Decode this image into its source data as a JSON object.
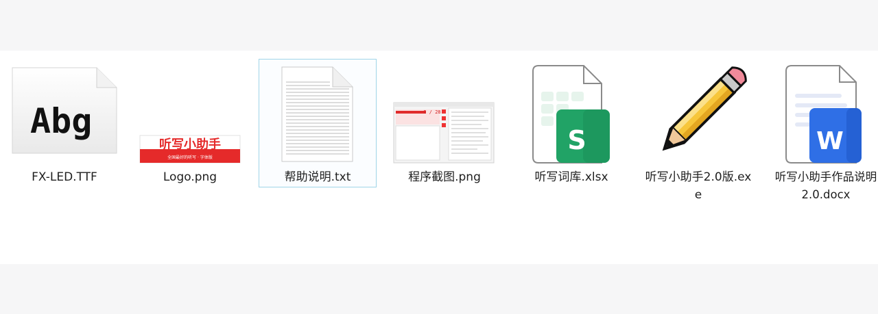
{
  "files": [
    {
      "name": "FX-LED.TTF",
      "icon": "font-file-icon",
      "preview": "Abg"
    },
    {
      "name": "Logo.png",
      "icon": "image-file-icon",
      "preview": {
        "title": "听写小助手",
        "subtitle": "全国最好的听写 · 字体版"
      }
    },
    {
      "name": "帮助说明.txt",
      "icon": "text-file-icon",
      "selected": true
    },
    {
      "name": "程序截图.png",
      "icon": "screenshot-thumbnail-icon",
      "preview": {
        "counter": "2 / 28"
      }
    },
    {
      "name": "听写词库.xlsx",
      "icon": "spreadsheet-file-icon",
      "badge": "S"
    },
    {
      "name": "听写小助手2.0版.exe",
      "icon": "pencil-exe-icon"
    },
    {
      "name": "听写小助手作品说明2.0.docx",
      "icon": "word-document-icon",
      "badge": "W"
    }
  ],
  "colors": {
    "selection_border": "#9fd5e8",
    "sheets_green": "#21a366",
    "word_blue": "#2f6fe6",
    "logo_red": "#e52a2a",
    "pencil_yellow": "#f7c63b"
  }
}
